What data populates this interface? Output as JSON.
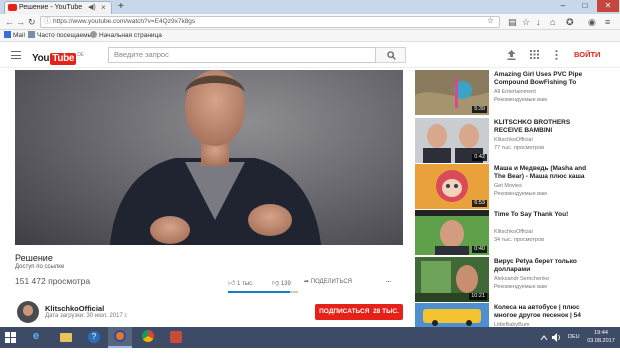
{
  "browser": {
    "tab_title": "Решение - YouTube",
    "url": "https://www.youtube.com/watch?v=E4Qz9x7k8gs",
    "bookmarks": [
      "Mail",
      "Часто посещаемые",
      "Начальная страница"
    ]
  },
  "youtube": {
    "logo_you": "You",
    "logo_tube": "Tube",
    "logo_region": "DE",
    "search_placeholder": "Введите запрос",
    "login_label": "ВОЙТИ"
  },
  "video": {
    "title": "Решение",
    "access_badge": "Доступ по ссылке",
    "views": "151 472 просмотра",
    "likes": "1 тыс.",
    "dislikes": "139",
    "like_ratio": 0.88,
    "share_label": "ПОДЕЛИТЬСЯ",
    "more_label": "...",
    "channel_name": "KlitschkoOfficial",
    "upload_date": "Дата загрузки: 30 июл. 2017 г.",
    "subscribe_label": "ПОДПИСАТЬСЯ",
    "subscriber_count": "28 ТЫС."
  },
  "related": [
    {
      "title": "Amazing Girl Uses PVC Pipe Compound BowFishing To",
      "channel": "All Entertainment",
      "meta": "Рекомендуемые вам",
      "duration": "5:39"
    },
    {
      "title": "KLITSCHKO BROTHERS RECEIVE BAMBINI",
      "channel": "KlitschkoOfficial",
      "meta": "77 тыс. просмотров",
      "duration": "0:42"
    },
    {
      "title": "Маша и Медведь (Masha and The Bear) - Маша плюс каша",
      "channel": "Get Movies",
      "meta": "Рекомендуемые вам",
      "duration": "6:53"
    },
    {
      "title": "Time To Say Thank You!",
      "channel": "KlitschkoOfficial",
      "meta": "34 тыс. просмотров",
      "duration": "0:40"
    },
    {
      "title": "Вирус Petya берет только долларами",
      "channel": "Aleksandr Semchenko",
      "meta": "Рекомендуемые вам",
      "duration": "10:21"
    },
    {
      "title": "Колеса на автобусе | плюс многое другое песенок | 54",
      "channel": "LittleBabyBum",
      "meta": "",
      "duration": ""
    }
  ],
  "taskbar": {
    "time": "19:44",
    "date": "03.08.2017",
    "lang": "DEU"
  },
  "colors": {
    "youtube_red": "#e62117",
    "link_blue": "#167ac6",
    "taskbar": "#3d4b66"
  }
}
